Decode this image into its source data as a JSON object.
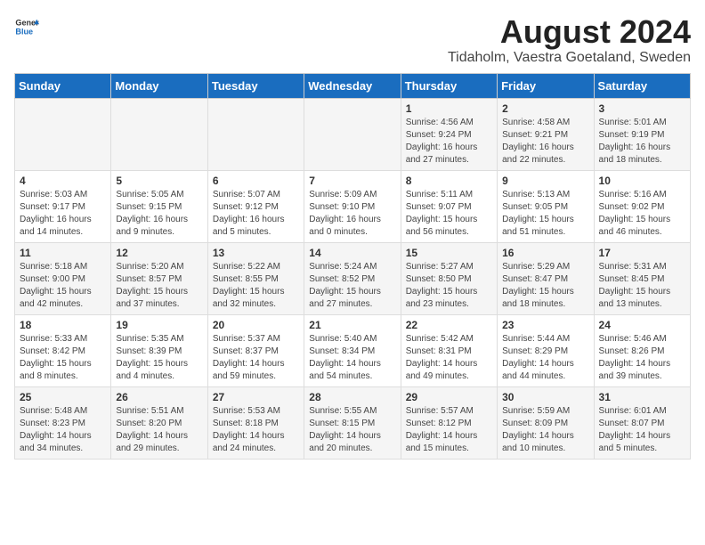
{
  "header": {
    "logo_general": "General",
    "logo_blue": "Blue",
    "title": "August 2024",
    "subtitle": "Tidaholm, Vaestra Goetaland, Sweden"
  },
  "days_of_week": [
    "Sunday",
    "Monday",
    "Tuesday",
    "Wednesday",
    "Thursday",
    "Friday",
    "Saturday"
  ],
  "weeks": [
    [
      {
        "num": "",
        "info": ""
      },
      {
        "num": "",
        "info": ""
      },
      {
        "num": "",
        "info": ""
      },
      {
        "num": "",
        "info": ""
      },
      {
        "num": "1",
        "info": "Sunrise: 4:56 AM\nSunset: 9:24 PM\nDaylight: 16 hours\nand 27 minutes."
      },
      {
        "num": "2",
        "info": "Sunrise: 4:58 AM\nSunset: 9:21 PM\nDaylight: 16 hours\nand 22 minutes."
      },
      {
        "num": "3",
        "info": "Sunrise: 5:01 AM\nSunset: 9:19 PM\nDaylight: 16 hours\nand 18 minutes."
      }
    ],
    [
      {
        "num": "4",
        "info": "Sunrise: 5:03 AM\nSunset: 9:17 PM\nDaylight: 16 hours\nand 14 minutes."
      },
      {
        "num": "5",
        "info": "Sunrise: 5:05 AM\nSunset: 9:15 PM\nDaylight: 16 hours\nand 9 minutes."
      },
      {
        "num": "6",
        "info": "Sunrise: 5:07 AM\nSunset: 9:12 PM\nDaylight: 16 hours\nand 5 minutes."
      },
      {
        "num": "7",
        "info": "Sunrise: 5:09 AM\nSunset: 9:10 PM\nDaylight: 16 hours\nand 0 minutes."
      },
      {
        "num": "8",
        "info": "Sunrise: 5:11 AM\nSunset: 9:07 PM\nDaylight: 15 hours\nand 56 minutes."
      },
      {
        "num": "9",
        "info": "Sunrise: 5:13 AM\nSunset: 9:05 PM\nDaylight: 15 hours\nand 51 minutes."
      },
      {
        "num": "10",
        "info": "Sunrise: 5:16 AM\nSunset: 9:02 PM\nDaylight: 15 hours\nand 46 minutes."
      }
    ],
    [
      {
        "num": "11",
        "info": "Sunrise: 5:18 AM\nSunset: 9:00 PM\nDaylight: 15 hours\nand 42 minutes."
      },
      {
        "num": "12",
        "info": "Sunrise: 5:20 AM\nSunset: 8:57 PM\nDaylight: 15 hours\nand 37 minutes."
      },
      {
        "num": "13",
        "info": "Sunrise: 5:22 AM\nSunset: 8:55 PM\nDaylight: 15 hours\nand 32 minutes."
      },
      {
        "num": "14",
        "info": "Sunrise: 5:24 AM\nSunset: 8:52 PM\nDaylight: 15 hours\nand 27 minutes."
      },
      {
        "num": "15",
        "info": "Sunrise: 5:27 AM\nSunset: 8:50 PM\nDaylight: 15 hours\nand 23 minutes."
      },
      {
        "num": "16",
        "info": "Sunrise: 5:29 AM\nSunset: 8:47 PM\nDaylight: 15 hours\nand 18 minutes."
      },
      {
        "num": "17",
        "info": "Sunrise: 5:31 AM\nSunset: 8:45 PM\nDaylight: 15 hours\nand 13 minutes."
      }
    ],
    [
      {
        "num": "18",
        "info": "Sunrise: 5:33 AM\nSunset: 8:42 PM\nDaylight: 15 hours\nand 8 minutes."
      },
      {
        "num": "19",
        "info": "Sunrise: 5:35 AM\nSunset: 8:39 PM\nDaylight: 15 hours\nand 4 minutes."
      },
      {
        "num": "20",
        "info": "Sunrise: 5:37 AM\nSunset: 8:37 PM\nDaylight: 14 hours\nand 59 minutes."
      },
      {
        "num": "21",
        "info": "Sunrise: 5:40 AM\nSunset: 8:34 PM\nDaylight: 14 hours\nand 54 minutes."
      },
      {
        "num": "22",
        "info": "Sunrise: 5:42 AM\nSunset: 8:31 PM\nDaylight: 14 hours\nand 49 minutes."
      },
      {
        "num": "23",
        "info": "Sunrise: 5:44 AM\nSunset: 8:29 PM\nDaylight: 14 hours\nand 44 minutes."
      },
      {
        "num": "24",
        "info": "Sunrise: 5:46 AM\nSunset: 8:26 PM\nDaylight: 14 hours\nand 39 minutes."
      }
    ],
    [
      {
        "num": "25",
        "info": "Sunrise: 5:48 AM\nSunset: 8:23 PM\nDaylight: 14 hours\nand 34 minutes."
      },
      {
        "num": "26",
        "info": "Sunrise: 5:51 AM\nSunset: 8:20 PM\nDaylight: 14 hours\nand 29 minutes."
      },
      {
        "num": "27",
        "info": "Sunrise: 5:53 AM\nSunset: 8:18 PM\nDaylight: 14 hours\nand 24 minutes."
      },
      {
        "num": "28",
        "info": "Sunrise: 5:55 AM\nSunset: 8:15 PM\nDaylight: 14 hours\nand 20 minutes."
      },
      {
        "num": "29",
        "info": "Sunrise: 5:57 AM\nSunset: 8:12 PM\nDaylight: 14 hours\nand 15 minutes."
      },
      {
        "num": "30",
        "info": "Sunrise: 5:59 AM\nSunset: 8:09 PM\nDaylight: 14 hours\nand 10 minutes."
      },
      {
        "num": "31",
        "info": "Sunrise: 6:01 AM\nSunset: 8:07 PM\nDaylight: 14 hours\nand 5 minutes."
      }
    ]
  ]
}
